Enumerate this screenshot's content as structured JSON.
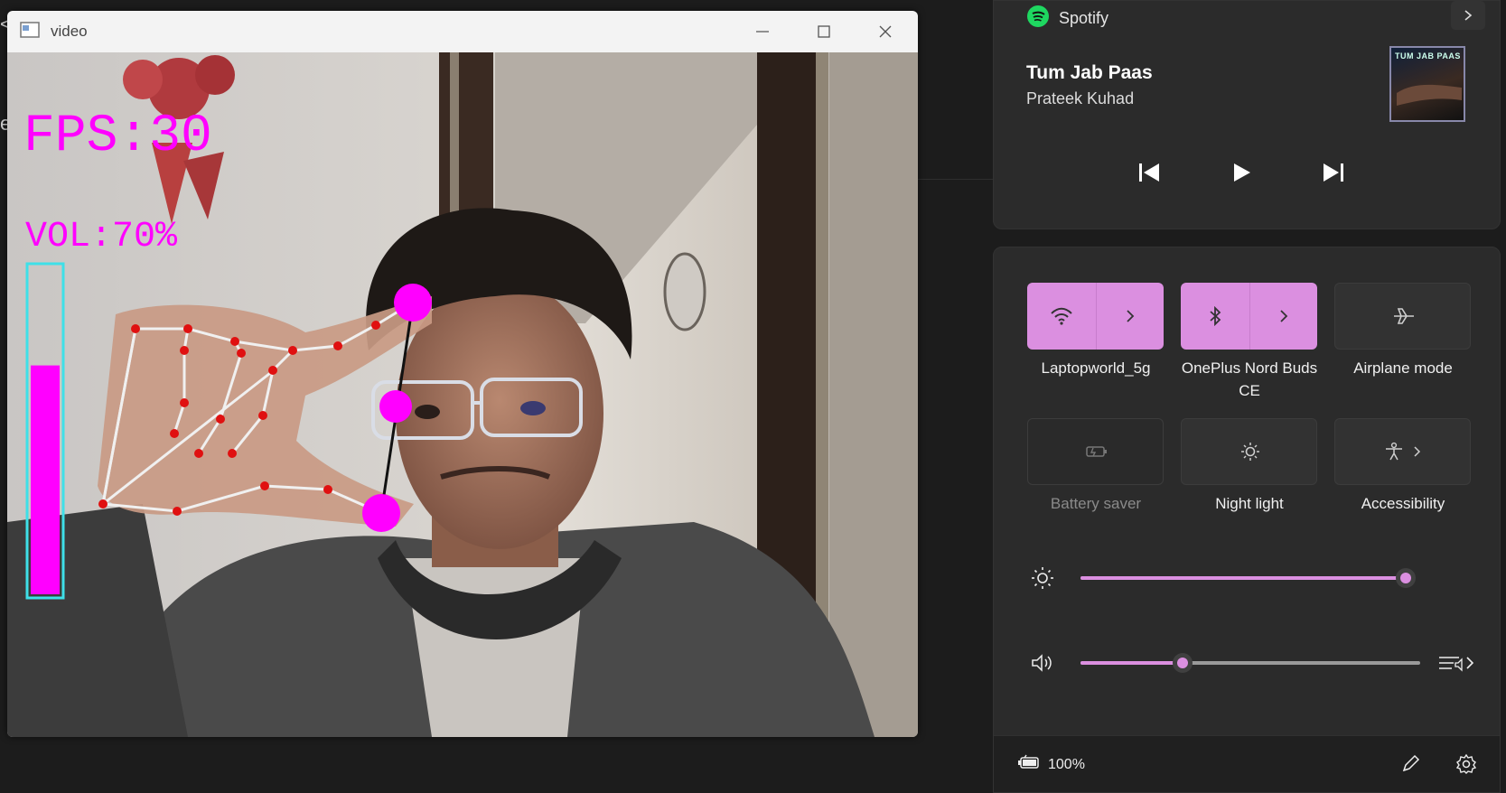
{
  "left_edge": {
    "frag1": "<",
    "frag2": "e"
  },
  "video_window": {
    "title": "video",
    "overlay": {
      "fps_text": "FPS:30",
      "vol_text": "VOL:70%",
      "volume_level_percent": 70
    }
  },
  "media": {
    "app_name": "Spotify",
    "song_title": "Tum Jab Paas",
    "artist": "Prateek Kuhad",
    "album_art_text": "TUM JAB PAAS"
  },
  "tiles": [
    {
      "label": "Laptopworld_5g",
      "icon": "wifi-icon",
      "state": "on"
    },
    {
      "label": "OnePlus Nord Buds CE",
      "icon": "bluetooth-icon",
      "state": "on"
    },
    {
      "label": "Airplane mode",
      "icon": "airplane-icon",
      "state": "off"
    },
    {
      "label": "Battery saver",
      "icon": "battery-saver-icon",
      "state": "disabled"
    },
    {
      "label": "Night light",
      "icon": "night-light-icon",
      "state": "off"
    },
    {
      "label": "Accessibility",
      "icon": "accessibility-icon",
      "state": "off"
    }
  ],
  "sliders": {
    "brightness": {
      "icon": "brightness-icon",
      "value_fraction": 0.99
    },
    "volume": {
      "icon": "speaker-icon",
      "value_fraction": 0.3
    }
  },
  "footer": {
    "battery_text": "100%",
    "edit_icon": "pencil-icon",
    "settings_icon": "gear-icon"
  },
  "colors": {
    "accent": "#db8fe0",
    "overlay_magenta": "#ff00ff",
    "landmark_red": "#e01010"
  }
}
